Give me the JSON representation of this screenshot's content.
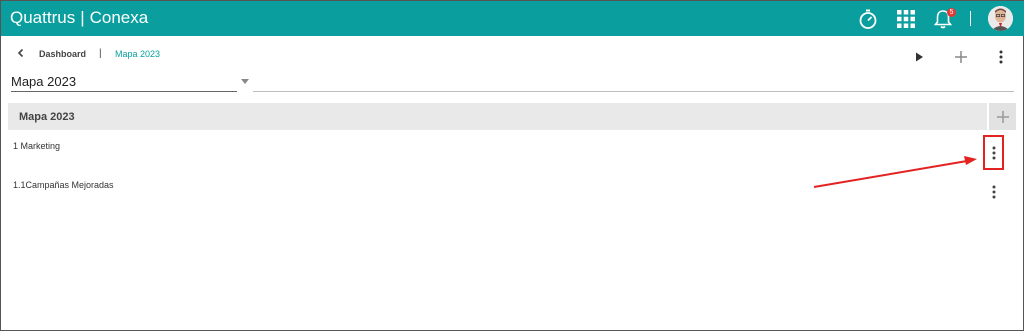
{
  "app": {
    "brand_left": "Quattrus",
    "brand_sep": "|",
    "brand_right": "Conexa",
    "accent_color": "#0a9e9e",
    "notification_count": "5"
  },
  "icons": {
    "timer": "stopwatch-icon",
    "apps": "apps-grid-icon",
    "notifications": "bell-icon",
    "avatar": "user-avatar",
    "back": "chevron-left-icon",
    "play": "play-icon",
    "add": "plus-icon",
    "more": "kebab-icon"
  },
  "breadcrumb": {
    "dashboard": "Dashboard",
    "separator": "|",
    "current": "Mapa 2023"
  },
  "map_select": {
    "value": "Mapa 2023"
  },
  "section": {
    "title": "Mapa 2023"
  },
  "rows": [
    {
      "label": "1 Marketing"
    },
    {
      "label": "1.1Campañas Mejoradas"
    }
  ],
  "annotation_color": "#e32222"
}
